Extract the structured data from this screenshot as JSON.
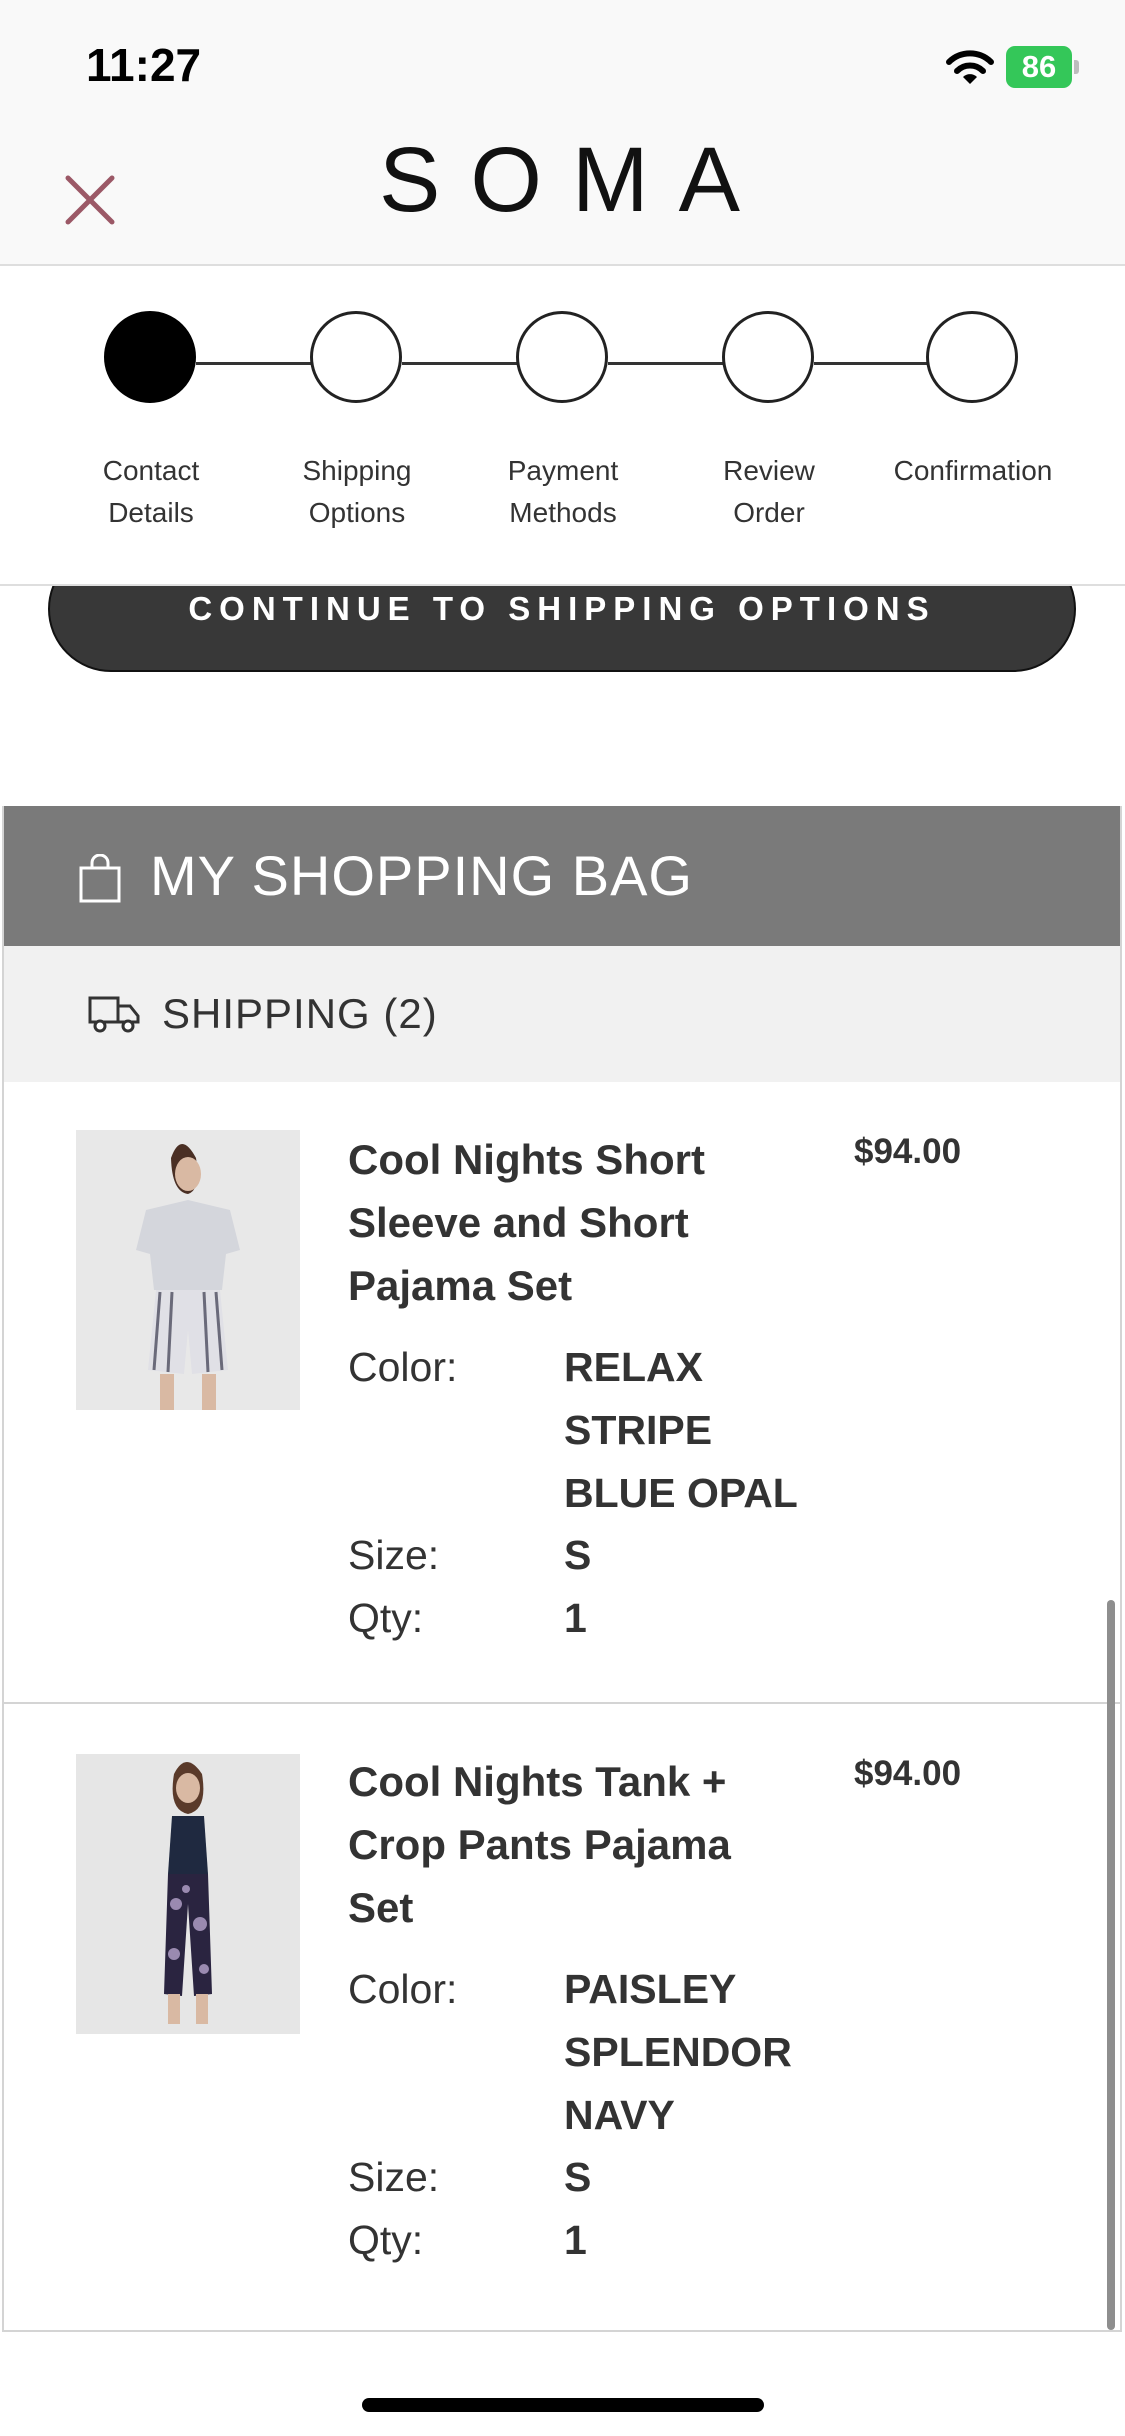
{
  "status_bar": {
    "time": "11:27",
    "battery": "86"
  },
  "header": {
    "brand": "SOMA",
    "close_icon": "close-icon"
  },
  "stepper": {
    "steps": [
      {
        "line1": "Contact",
        "line2": "Details",
        "active": true
      },
      {
        "line1": "Shipping",
        "line2": "Options",
        "active": false
      },
      {
        "line1": "Payment",
        "line2": "Methods",
        "active": false
      },
      {
        "line1": "Review",
        "line2": "Order",
        "active": false
      },
      {
        "line1": "Confirmation",
        "line2": "",
        "active": false
      }
    ]
  },
  "continue_button": {
    "label": "CONTINUE TO SHIPPING OPTIONS"
  },
  "bag": {
    "title": "MY SHOPPING BAG",
    "shipping_label": "SHIPPING (2)",
    "labels": {
      "color": "Color:",
      "size": "Size:",
      "qty": "Qty:"
    },
    "items": [
      {
        "name_lines": [
          "Cool Nights Short",
          "Sleeve and Short",
          "Pajama Set"
        ],
        "price": "$94.00",
        "color_lines": [
          "RELAX",
          "STRIPE",
          "BLUE OPAL"
        ],
        "size": "S",
        "qty": "1"
      },
      {
        "name_lines": [
          "Cool Nights Tank +",
          "Crop Pants Pajama",
          "Set"
        ],
        "price": "$94.00",
        "color_lines": [
          "PAISLEY",
          "SPLENDOR",
          "NAVY"
        ],
        "size": "S",
        "qty": "1"
      }
    ]
  },
  "colors": {
    "accent": "#9b5866",
    "bag_header": "#7a7a7a",
    "button": "#383838",
    "battery": "#34c759"
  }
}
